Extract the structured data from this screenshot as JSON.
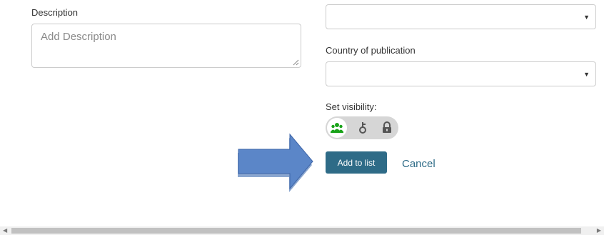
{
  "description": {
    "label": "Description",
    "placeholder": "Add Description"
  },
  "top_select": {
    "value": ""
  },
  "country": {
    "label": "Country of publication",
    "value": ""
  },
  "visibility": {
    "label": "Set visibility:",
    "options": [
      "group-icon",
      "key-icon",
      "lock-icon"
    ],
    "selected": "group-icon",
    "selected_color": "#1aa31a"
  },
  "actions": {
    "add_label": "Add to list",
    "cancel_label": "Cancel"
  },
  "colors": {
    "primary": "#2e6b87",
    "arrow": "#5b86c8"
  }
}
